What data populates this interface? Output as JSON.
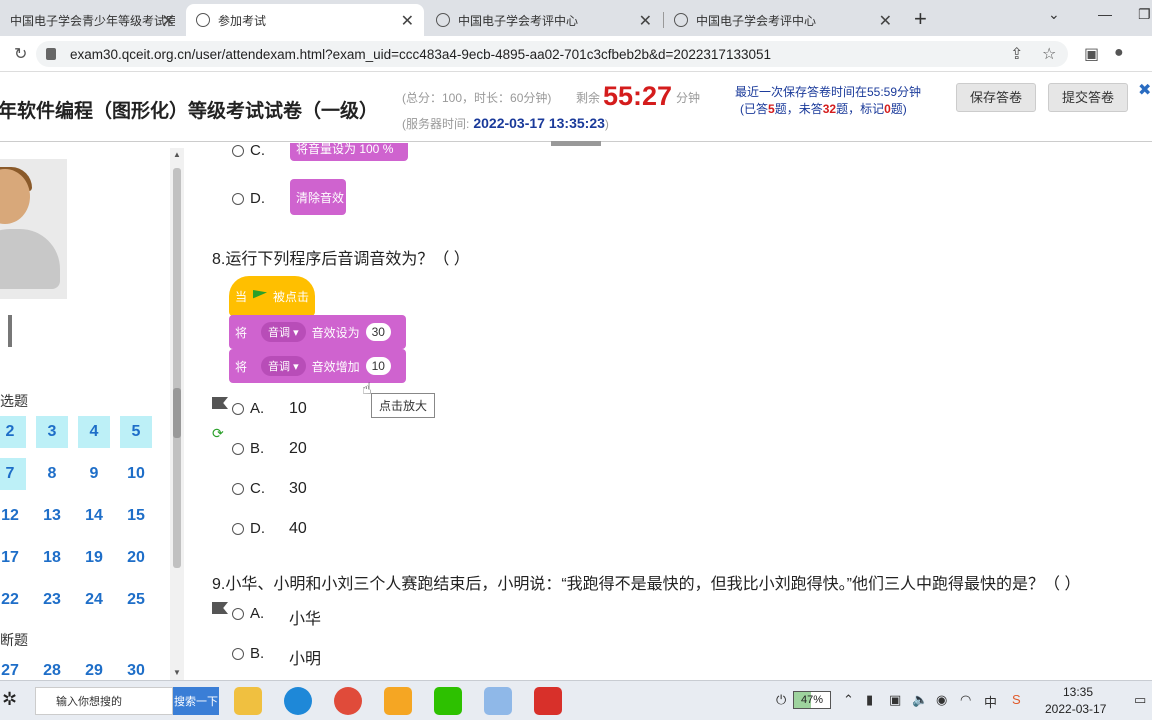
{
  "browser": {
    "tabs": [
      {
        "title": "中国电子学会青少年等级考试官网",
        "active": false
      },
      {
        "title": "参加考试",
        "active": true
      },
      {
        "title": "中国电子学会考评中心",
        "active": false
      },
      {
        "title": "中国电子学会考评中心",
        "active": false
      }
    ],
    "url": "exam30.qceit.org.cn/user/attendexam.html?exam_uid=ccc483a4-9ecb-4895-aa02-701c3cfbeb2b&d=2022317133051"
  },
  "exam": {
    "title": "年软件编程（图形化）等级考试试卷（一级）",
    "meta": "(总分：100，时长：60分钟)",
    "server_label": "(服务器时间:",
    "server_time": "2022-03-17 13:35:23",
    "server_close": ")",
    "remain_label": "剩余",
    "timer": "55:27",
    "timer_unit": "分钟",
    "save_time": "最近一次保存答卷时间在55:59分钟",
    "answered_pre": "(已答",
    "answered": "5",
    "unanswered_pre": "题，未答",
    "unanswered": "32",
    "marked_pre": "题，标记",
    "marked": "0",
    "marked_post": "题)",
    "save_button": "保存答卷",
    "submit_button": "提交答卷",
    "hdr_edge": "✖"
  },
  "sidebar": {
    "section1": "选题",
    "section2": "断题",
    "row1": [
      "2",
      "3",
      "4",
      "5"
    ],
    "row2": [
      "7",
      "8",
      "9",
      "10"
    ],
    "row3": [
      "12",
      "13",
      "14",
      "15"
    ],
    "row4": [
      "17",
      "18",
      "19",
      "20"
    ],
    "row5": [
      "22",
      "23",
      "24",
      "25"
    ],
    "row6": [
      "27",
      "28",
      "29",
      "30"
    ],
    "answered_row1": [
      "2",
      "3",
      "4",
      "5"
    ],
    "answered_row2": [
      "7"
    ]
  },
  "questions": {
    "prev_c_label": "C.",
    "prev_c_block": "将音量设为 100 %",
    "prev_d_label": "D.",
    "prev_d_block": "清除音效",
    "q8": {
      "text": "8.运行下列程序后音调音效为？（ ）",
      "block_hat": "当",
      "block_hat_suffix": "被点击",
      "block1_prefix": "将",
      "block1_dropdown": "音调 ▾",
      "block1_mid": "音效设为",
      "block1_value": "30",
      "block2_prefix": "将",
      "block2_dropdown": "音调 ▾",
      "block2_mid": "音效增加",
      "block2_value": "10",
      "tooltip": "点击放大",
      "options": [
        {
          "label": "A.",
          "value": "10"
        },
        {
          "label": "B.",
          "value": "20"
        },
        {
          "label": "C.",
          "value": "30"
        },
        {
          "label": "D.",
          "value": "40"
        }
      ]
    },
    "q9": {
      "text": "9.小华、小明和小刘三个人赛跑结束后，小明说：“我跑得不是最快的，但我比小刘跑得快。”他们三人中跑得最快的是？（ ）",
      "options": [
        {
          "label": "A.",
          "value": "小华"
        },
        {
          "label": "B.",
          "value": "小明"
        }
      ]
    }
  },
  "taskbar": {
    "search_placeholder": "输入你想搜的",
    "search_button": "搜索一下",
    "battery": "47%",
    "battery_level": 0.47,
    "ime": "中",
    "time": "13:35",
    "date": "2022-03-17"
  }
}
